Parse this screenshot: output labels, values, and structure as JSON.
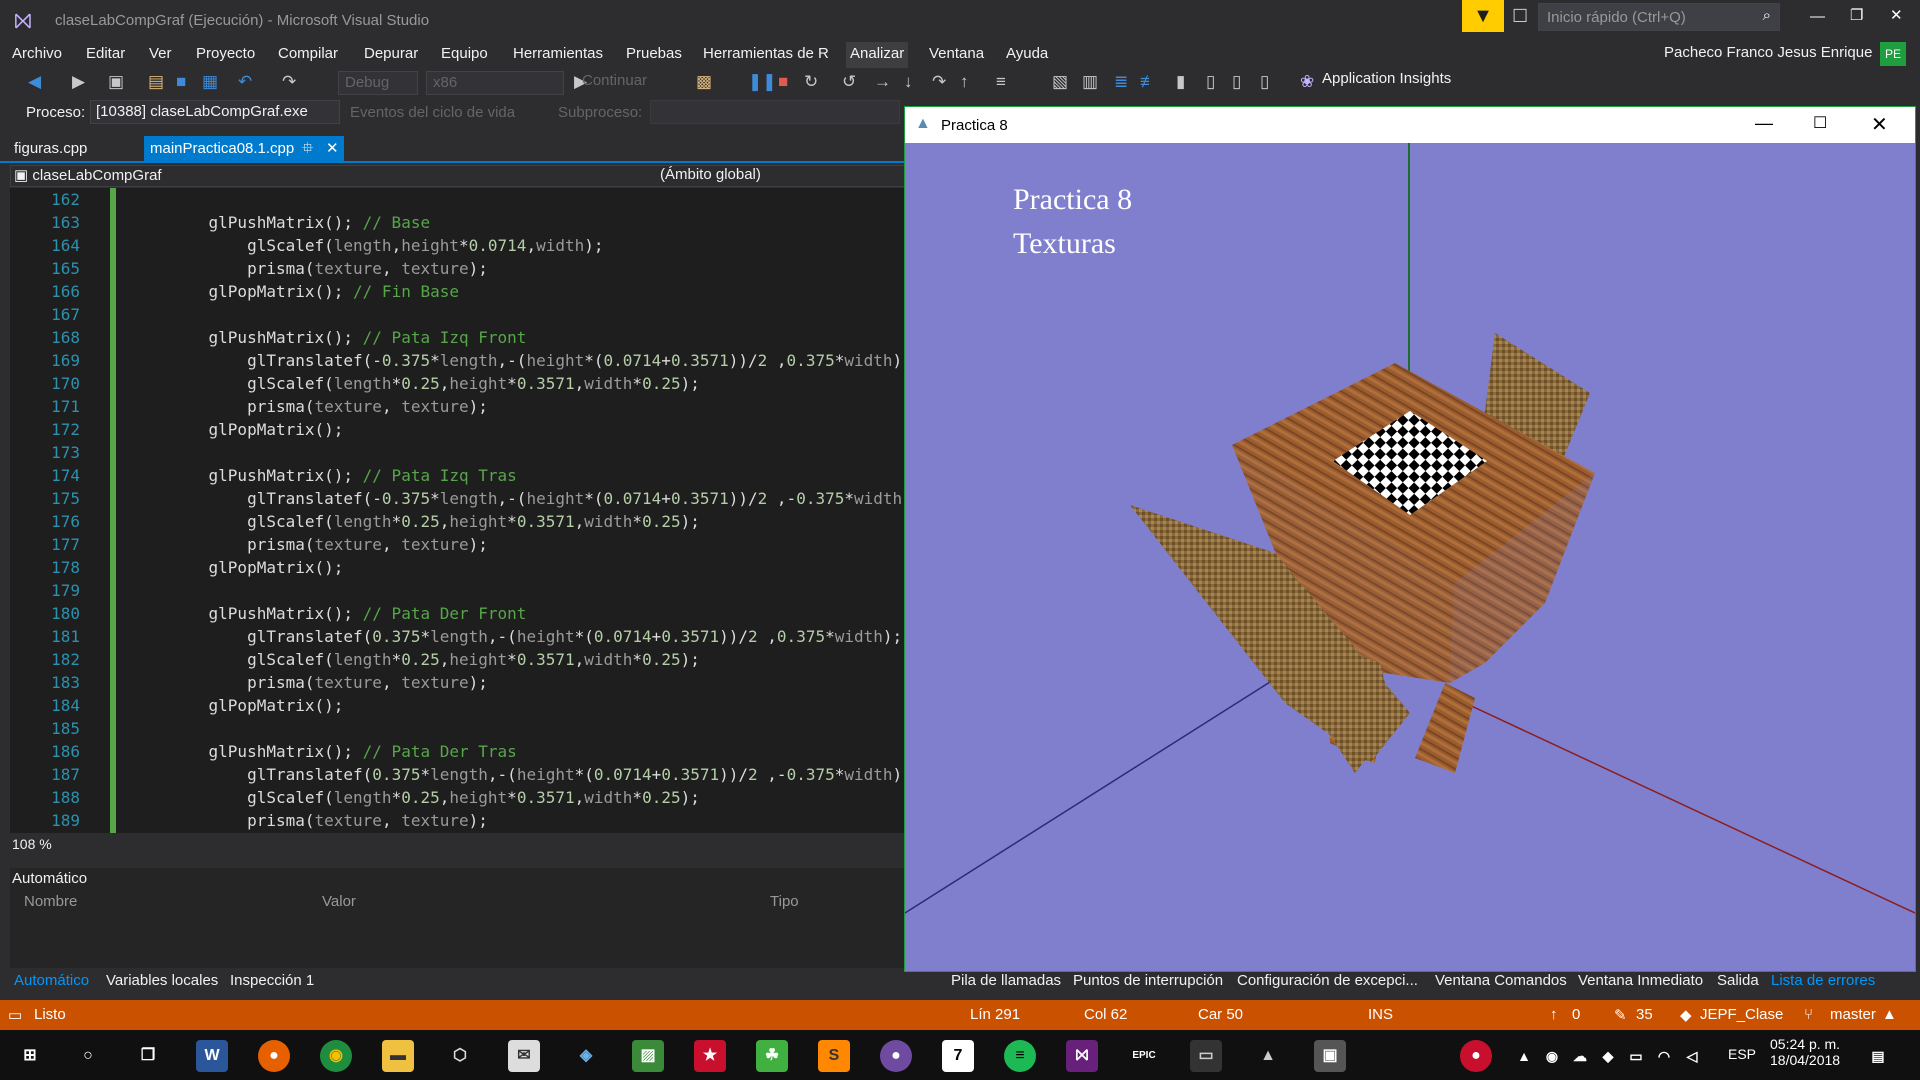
{
  "window": {
    "title": "claseLabCompGraf (Ejecución) - Microsoft Visual Studio",
    "quick_launch_placeholder": "Inicio rápido (Ctrl+Q)",
    "user_name": "Pacheco Franco Jesus Enrique",
    "user_initials": "PE"
  },
  "menu": [
    "Archivo",
    "Editar",
    "Ver",
    "Proyecto",
    "Compilar",
    "Depurar",
    "Equipo",
    "Herramientas",
    "Pruebas",
    "Herramientas de R",
    "Analizar",
    "Ventana",
    "Ayuda"
  ],
  "toolbar": {
    "config": "Debug",
    "platform": "x86",
    "continue_label": "Continuar",
    "app_insights": "Application Insights"
  },
  "process_bar": {
    "label": "Proceso:",
    "process": "[10388] claseLabCompGraf.exe",
    "lifecycle": "Eventos del ciclo de vida",
    "subprocess_label": "Subproceso:"
  },
  "tabs": {
    "file1": "figuras.cpp",
    "file2": "mainPractica08.1.cpp"
  },
  "nav": {
    "project": "claseLabCompGraf",
    "scope": "(Ámbito global)"
  },
  "code_lines": [
    {
      "n": "162",
      "segs": [
        {
          "t": ""
        }
      ]
    },
    {
      "n": "163",
      "segs": [
        {
          "t": "    glPushMatrix(); "
        },
        {
          "t": "// Base",
          "c": "cm"
        }
      ]
    },
    {
      "n": "164",
      "segs": [
        {
          "t": "        glScalef("
        },
        {
          "t": "length",
          "c": "par"
        },
        {
          "t": ","
        },
        {
          "t": "height",
          "c": "par"
        },
        {
          "t": "*"
        },
        {
          "t": "0.0714",
          "c": "num"
        },
        {
          "t": ","
        },
        {
          "t": "width",
          "c": "par"
        },
        {
          "t": ");"
        }
      ]
    },
    {
      "n": "165",
      "segs": [
        {
          "t": "        prisma("
        },
        {
          "t": "texture",
          "c": "par"
        },
        {
          "t": ", "
        },
        {
          "t": "texture",
          "c": "par"
        },
        {
          "t": ");"
        }
      ]
    },
    {
      "n": "166",
      "segs": [
        {
          "t": "    glPopMatrix(); "
        },
        {
          "t": "// Fin Base",
          "c": "cm"
        }
      ]
    },
    {
      "n": "167",
      "segs": [
        {
          "t": ""
        }
      ]
    },
    {
      "n": "168",
      "segs": [
        {
          "t": "    glPushMatrix(); "
        },
        {
          "t": "// Pata Izq Front",
          "c": "cm"
        }
      ]
    },
    {
      "n": "169",
      "segs": [
        {
          "t": "        glTranslatef(-"
        },
        {
          "t": "0.375",
          "c": "num"
        },
        {
          "t": "*"
        },
        {
          "t": "length",
          "c": "par"
        },
        {
          "t": ",-("
        },
        {
          "t": "height",
          "c": "par"
        },
        {
          "t": "*("
        },
        {
          "t": "0.0714",
          "c": "num"
        },
        {
          "t": "+"
        },
        {
          "t": "0.3571",
          "c": "num"
        },
        {
          "t": "))/"
        },
        {
          "t": "2",
          "c": "num"
        },
        {
          "t": " ,"
        },
        {
          "t": "0.375",
          "c": "num"
        },
        {
          "t": "*"
        },
        {
          "t": "width",
          "c": "par"
        },
        {
          "t": ");"
        }
      ]
    },
    {
      "n": "170",
      "segs": [
        {
          "t": "        glScalef("
        },
        {
          "t": "length",
          "c": "par"
        },
        {
          "t": "*"
        },
        {
          "t": "0.25",
          "c": "num"
        },
        {
          "t": ","
        },
        {
          "t": "height",
          "c": "par"
        },
        {
          "t": "*"
        },
        {
          "t": "0.3571",
          "c": "num"
        },
        {
          "t": ","
        },
        {
          "t": "width",
          "c": "par"
        },
        {
          "t": "*"
        },
        {
          "t": "0.25",
          "c": "num"
        },
        {
          "t": ");"
        }
      ]
    },
    {
      "n": "171",
      "segs": [
        {
          "t": "        prisma("
        },
        {
          "t": "texture",
          "c": "par"
        },
        {
          "t": ", "
        },
        {
          "t": "texture",
          "c": "par"
        },
        {
          "t": ");"
        }
      ]
    },
    {
      "n": "172",
      "segs": [
        {
          "t": "    glPopMatrix();"
        }
      ]
    },
    {
      "n": "173",
      "segs": [
        {
          "t": ""
        }
      ]
    },
    {
      "n": "174",
      "segs": [
        {
          "t": "    glPushMatrix(); "
        },
        {
          "t": "// Pata Izq Tras",
          "c": "cm"
        }
      ]
    },
    {
      "n": "175",
      "segs": [
        {
          "t": "        glTranslatef(-"
        },
        {
          "t": "0.375",
          "c": "num"
        },
        {
          "t": "*"
        },
        {
          "t": "length",
          "c": "par"
        },
        {
          "t": ",-("
        },
        {
          "t": "height",
          "c": "par"
        },
        {
          "t": "*("
        },
        {
          "t": "0.0714",
          "c": "num"
        },
        {
          "t": "+"
        },
        {
          "t": "0.3571",
          "c": "num"
        },
        {
          "t": "))/"
        },
        {
          "t": "2",
          "c": "num"
        },
        {
          "t": " ,-"
        },
        {
          "t": "0.375",
          "c": "num"
        },
        {
          "t": "*"
        },
        {
          "t": "width",
          "c": "par"
        },
        {
          "t": ");"
        }
      ]
    },
    {
      "n": "176",
      "segs": [
        {
          "t": "        glScalef("
        },
        {
          "t": "length",
          "c": "par"
        },
        {
          "t": "*"
        },
        {
          "t": "0.25",
          "c": "num"
        },
        {
          "t": ","
        },
        {
          "t": "height",
          "c": "par"
        },
        {
          "t": "*"
        },
        {
          "t": "0.3571",
          "c": "num"
        },
        {
          "t": ","
        },
        {
          "t": "width",
          "c": "par"
        },
        {
          "t": "*"
        },
        {
          "t": "0.25",
          "c": "num"
        },
        {
          "t": ");"
        }
      ]
    },
    {
      "n": "177",
      "segs": [
        {
          "t": "        prisma("
        },
        {
          "t": "texture",
          "c": "par"
        },
        {
          "t": ", "
        },
        {
          "t": "texture",
          "c": "par"
        },
        {
          "t": ");"
        }
      ]
    },
    {
      "n": "178",
      "segs": [
        {
          "t": "    glPopMatrix();"
        }
      ]
    },
    {
      "n": "179",
      "segs": [
        {
          "t": ""
        }
      ]
    },
    {
      "n": "180",
      "segs": [
        {
          "t": "    glPushMatrix(); "
        },
        {
          "t": "// Pata Der Front",
          "c": "cm"
        }
      ]
    },
    {
      "n": "181",
      "segs": [
        {
          "t": "        glTranslatef("
        },
        {
          "t": "0.375",
          "c": "num"
        },
        {
          "t": "*"
        },
        {
          "t": "length",
          "c": "par"
        },
        {
          "t": ",-("
        },
        {
          "t": "height",
          "c": "par"
        },
        {
          "t": "*("
        },
        {
          "t": "0.0714",
          "c": "num"
        },
        {
          "t": "+"
        },
        {
          "t": "0.3571",
          "c": "num"
        },
        {
          "t": "))/"
        },
        {
          "t": "2",
          "c": "num"
        },
        {
          "t": " ,"
        },
        {
          "t": "0.375",
          "c": "num"
        },
        {
          "t": "*"
        },
        {
          "t": "width",
          "c": "par"
        },
        {
          "t": ");"
        }
      ]
    },
    {
      "n": "182",
      "segs": [
        {
          "t": "        glScalef("
        },
        {
          "t": "length",
          "c": "par"
        },
        {
          "t": "*"
        },
        {
          "t": "0.25",
          "c": "num"
        },
        {
          "t": ","
        },
        {
          "t": "height",
          "c": "par"
        },
        {
          "t": "*"
        },
        {
          "t": "0.3571",
          "c": "num"
        },
        {
          "t": ","
        },
        {
          "t": "width",
          "c": "par"
        },
        {
          "t": "*"
        },
        {
          "t": "0.25",
          "c": "num"
        },
        {
          "t": ");"
        }
      ]
    },
    {
      "n": "183",
      "segs": [
        {
          "t": "        prisma("
        },
        {
          "t": "texture",
          "c": "par"
        },
        {
          "t": ", "
        },
        {
          "t": "texture",
          "c": "par"
        },
        {
          "t": ");"
        }
      ]
    },
    {
      "n": "184",
      "segs": [
        {
          "t": "    glPopMatrix();"
        }
      ]
    },
    {
      "n": "185",
      "segs": [
        {
          "t": ""
        }
      ]
    },
    {
      "n": "186",
      "segs": [
        {
          "t": "    glPushMatrix(); "
        },
        {
          "t": "// Pata Der Tras",
          "c": "cm"
        }
      ]
    },
    {
      "n": "187",
      "segs": [
        {
          "t": "        glTranslatef("
        },
        {
          "t": "0.375",
          "c": "num"
        },
        {
          "t": "*"
        },
        {
          "t": "length",
          "c": "par"
        },
        {
          "t": ",-("
        },
        {
          "t": "height",
          "c": "par"
        },
        {
          "t": "*("
        },
        {
          "t": "0.0714",
          "c": "num"
        },
        {
          "t": "+"
        },
        {
          "t": "0.3571",
          "c": "num"
        },
        {
          "t": "))/"
        },
        {
          "t": "2",
          "c": "num"
        },
        {
          "t": " ,-"
        },
        {
          "t": "0.375",
          "c": "num"
        },
        {
          "t": "*"
        },
        {
          "t": "width",
          "c": "par"
        },
        {
          "t": ");"
        }
      ]
    },
    {
      "n": "188",
      "segs": [
        {
          "t": "        glScalef("
        },
        {
          "t": "length",
          "c": "par"
        },
        {
          "t": "*"
        },
        {
          "t": "0.25",
          "c": "num"
        },
        {
          "t": ","
        },
        {
          "t": "height",
          "c": "par"
        },
        {
          "t": "*"
        },
        {
          "t": "0.3571",
          "c": "num"
        },
        {
          "t": ","
        },
        {
          "t": "width",
          "c": "par"
        },
        {
          "t": "*"
        },
        {
          "t": "0.25",
          "c": "num"
        },
        {
          "t": ");"
        }
      ]
    },
    {
      "n": "189",
      "segs": [
        {
          "t": "        prisma("
        },
        {
          "t": "texture",
          "c": "par"
        },
        {
          "t": ", "
        },
        {
          "t": "texture",
          "c": "par"
        },
        {
          "t": ");"
        }
      ]
    }
  ],
  "zoom": "108 %",
  "auto_panel": {
    "title": "Automático",
    "col_name": "Nombre",
    "col_value": "Valor",
    "col_type": "Tipo"
  },
  "bottom_tabs_left": [
    "Automático",
    "Variables locales",
    "Inspección 1"
  ],
  "bottom_tabs_right": [
    "Pila de llamadas",
    "Puntos de interrupción",
    "Configuración de excepci...",
    "Ventana Comandos",
    "Ventana Inmediato",
    "Salida",
    "Lista de errores"
  ],
  "status": {
    "ready": "Listo",
    "line": "Lín 291",
    "col": "Col 62",
    "char": "Car 50",
    "mode": "INS",
    "up_count": "0",
    "edit_count": "35",
    "repo": "JEPF_Clase",
    "branch": "master"
  },
  "gl_window": {
    "title": "Practica 8",
    "text1": "Practica 8",
    "text2": "Texturas",
    "bg_color": "#807fcd"
  },
  "tray": {
    "lang": "ESP",
    "time": "05:24 p. m.",
    "date": "18/04/2018"
  },
  "colors": {
    "status_bar": "#ca5100",
    "accent": "#007acc"
  }
}
